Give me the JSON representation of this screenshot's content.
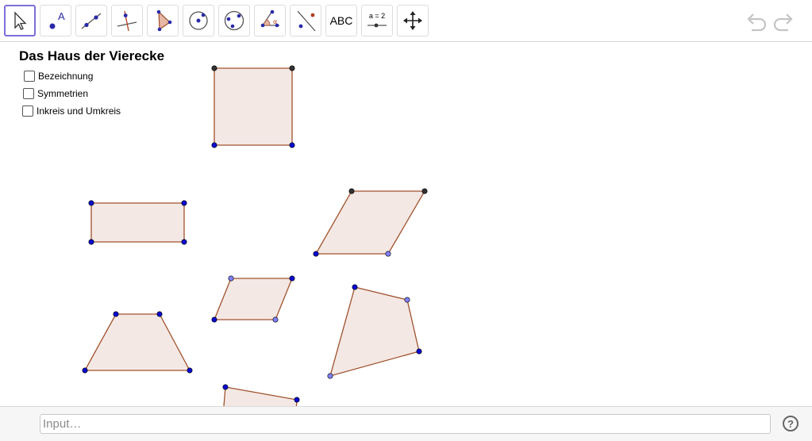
{
  "toolbar": {
    "tools": [
      {
        "name": "move-tool",
        "icon": "arrow-cursor-icon"
      },
      {
        "name": "point-tool",
        "icon": "point-a-icon",
        "label": "A"
      },
      {
        "name": "line-tool",
        "icon": "line-icon"
      },
      {
        "name": "perpendicular-line-tool",
        "icon": "perpendicular-icon"
      },
      {
        "name": "polygon-tool",
        "icon": "polygon-icon"
      },
      {
        "name": "circle-tool",
        "icon": "circle-center-icon"
      },
      {
        "name": "circle-three-points-tool",
        "icon": "circle-three-points-icon"
      },
      {
        "name": "angle-tool",
        "icon": "angle-icon",
        "label": "α"
      },
      {
        "name": "reflect-tool",
        "icon": "reflect-icon"
      },
      {
        "name": "text-tool",
        "icon": "text-icon",
        "label": "ABC"
      },
      {
        "name": "slider-tool",
        "icon": "slider-icon",
        "label": "a = 2"
      },
      {
        "name": "move-graphics-view-tool",
        "icon": "move-view-icon"
      }
    ],
    "undo_icon": "undo-icon",
    "redo_icon": "redo-icon"
  },
  "canvas": {
    "title": "Das Haus der Vierecke",
    "checkboxes": [
      {
        "label": "Bezeichnung",
        "checked": false
      },
      {
        "label": "Symmetrien",
        "checked": false
      },
      {
        "label": "Inkreis und Umkreis",
        "checked": false
      }
    ],
    "colors": {
      "polygon_fill": "#f4e8e4",
      "polygon_edge": "#a0522d",
      "point_blue": "#0a0ad0",
      "point_light": "#8080ff",
      "point_dark": "#333333"
    }
  },
  "input": {
    "placeholder": "Input…",
    "help_label": "?"
  }
}
